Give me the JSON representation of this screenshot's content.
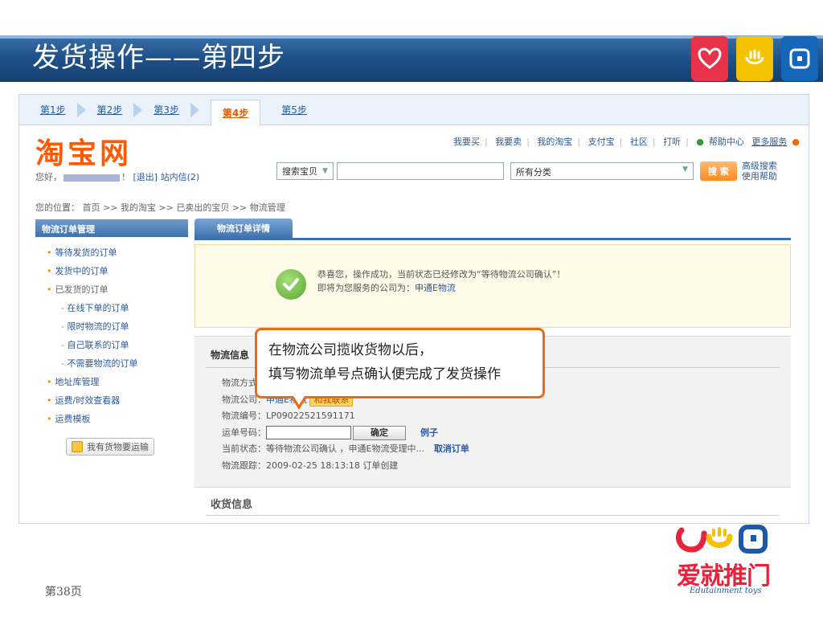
{
  "title": "发货操作——第四步",
  "tile_colors": [
    "#e8334a",
    "#f5c200",
    "#1566b8"
  ],
  "steps": [
    "第1步",
    "第2步",
    "第3步",
    "第4步",
    "第5步"
  ],
  "active_step": "第4步",
  "site": {
    "logo": "淘宝网",
    "greeting": "您好，",
    "greeting_tail": "！",
    "logout": "[退出]",
    "inbox": "站内信(2)",
    "toplinks": [
      "我要买",
      "我要卖",
      "我的淘宝",
      "支付宝",
      "社区",
      "打听"
    ],
    "help": "帮助中心",
    "more": "更多服务",
    "search_select": "搜索宝贝",
    "category_select": "所有分类",
    "search_button": "搜 索",
    "adv_search": "高级搜索",
    "use_help": "使用帮助"
  },
  "breadcrumb": "您的位置： 首页 >> 我的淘宝 >> 已卖出的宝贝 >> 物流管理",
  "left_menu": {
    "header": "物流订单管理",
    "items": [
      "等待发货的订单",
      "发货中的订单",
      "已发货的订单"
    ],
    "sub_items": [
      "在线下单的订单",
      "限时物流的订单",
      "自己联系的订单",
      "不需要物流的订单"
    ],
    "items2": [
      "地址库管理",
      "运费/时效查看器",
      "运费模板"
    ],
    "button": "我有货物要运输"
  },
  "tab_label": "物流订单详情",
  "success": {
    "line1": "恭喜您，操作成功，当前状态已经修改为“等待物流公司确认”！",
    "line2_prefix": "即将为您服务的公司为：",
    "company": "申通E物流"
  },
  "logistics": {
    "header": "物流信息",
    "method_label": "物流方式：",
    "company_label": "物流公司：",
    "company_value": "申通E物流",
    "contact": "和我联系",
    "id_label": "物流编号：",
    "id_value": "LP09022521591171",
    "tracking_label": "运单号码：",
    "confirm_button": "确定",
    "example_link": "例子",
    "status_label": "当前状态：",
    "status_value": "等待物流公司确认 ，申通E物流受理中...",
    "cancel_link": "取消订单",
    "trace_label": "物流跟踪：",
    "trace_value": "2009-02-25 18:13:18  订单创建"
  },
  "receive_header": "收货信息",
  "callout": {
    "line1": "在物流公司揽收货物以后，",
    "line2": "填写物流单号点确认便完成了发货操作"
  },
  "page_number": "第38页",
  "brand": {
    "name": "爱就推门",
    "tagline": "Edutainment toys"
  }
}
